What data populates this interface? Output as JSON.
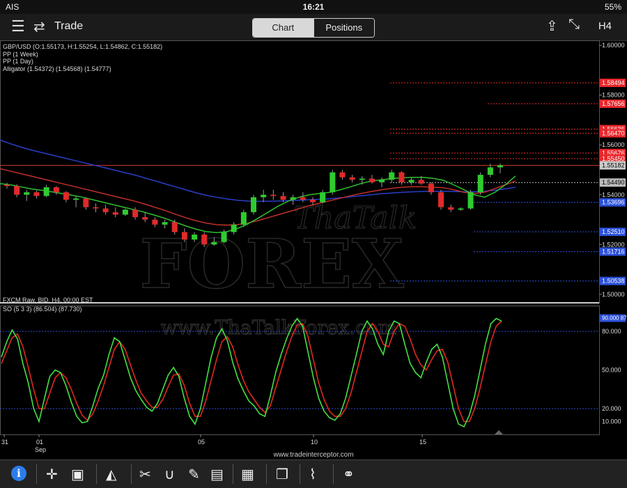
{
  "status": {
    "carrier": "AIS",
    "time": "16:21",
    "battery": "55%"
  },
  "nav": {
    "title": "Trade",
    "tabs": [
      "Chart",
      "Positions"
    ],
    "timeframe": "H4"
  },
  "legend": {
    "line1": "GBP/USD (O:1.55173, H:1.55254, L:1.54862, C:1.55182)",
    "line2": "PP (1 Week)",
    "line3": "PP (1 Day)",
    "line4": "Alligator  (1.54372) (1.54568) (1.54777)",
    "feed": "FXCM Raw, BID, H4, 00:00 EST",
    "osc": "SO (5 3 3)  (86.504)  (87.730)"
  },
  "watermark": {
    "line1": "ThaTalk",
    "line2": "FOREX",
    "url": "www.ThaTalkForex.com"
  },
  "footer": "www.tradeinterceptor.com",
  "chart_data": {
    "type": "candlestick",
    "symbol": "GBP/USD",
    "ylim": [
      1.4966,
      1.602
    ],
    "y_ticks": [
      "1.60000",
      "1.58000",
      "1.56000",
      "1.54000",
      "1.52000",
      "1.50000"
    ],
    "x_labels": [
      "31",
      "01",
      "05",
      "10",
      "15"
    ],
    "x_sublabel": "Sep",
    "current_price": "1.55182",
    "current_value": 1.55182,
    "price_labels": [
      {
        "text": "1.58494",
        "value": 1.58494,
        "color": "#e8272b"
      },
      {
        "text": "1.57656",
        "value": 1.57656,
        "color": "#e8272b"
      },
      {
        "text": "1.56636",
        "value": 1.56636,
        "color": "#e8272b"
      },
      {
        "text": "1.56470",
        "value": 1.5647,
        "color": "#e8272b"
      },
      {
        "text": "1.55676",
        "value": 1.55676,
        "color": "#e8272b"
      },
      {
        "text": "1.55450",
        "value": 1.5545,
        "color": "#e8272b"
      },
      {
        "text": "1.54490",
        "value": 1.5449,
        "color": "#bbbbbb"
      },
      {
        "text": "1.53696",
        "value": 1.53696,
        "color": "#2b50d8"
      },
      {
        "text": "1.52510",
        "value": 1.5251,
        "color": "#2b50d8"
      },
      {
        "text": "1.51716",
        "value": 1.51716,
        "color": "#2b50d8"
      },
      {
        "text": "1.50538",
        "value": 1.50538,
        "color": "#2b50d8"
      }
    ],
    "candles": [
      [
        1.544,
        1.5448,
        1.5425,
        1.5435
      ],
      [
        1.5435,
        1.5442,
        1.539,
        1.54
      ],
      [
        1.54,
        1.542,
        1.5375,
        1.541
      ],
      [
        1.541,
        1.5418,
        1.5385,
        1.5395
      ],
      [
        1.5395,
        1.544,
        1.539,
        1.543
      ],
      [
        1.543,
        1.5435,
        1.54,
        1.541
      ],
      [
        1.541,
        1.5415,
        1.537,
        1.538
      ],
      [
        1.538,
        1.5395,
        1.535,
        1.5385
      ],
      [
        1.5385,
        1.539,
        1.534,
        1.535
      ],
      [
        1.535,
        1.5365,
        1.533,
        1.5345
      ],
      [
        1.5345,
        1.536,
        1.532,
        1.533
      ],
      [
        1.533,
        1.535,
        1.531,
        1.532
      ],
      [
        1.532,
        1.5345,
        1.5315,
        1.534
      ],
      [
        1.534,
        1.535,
        1.53,
        1.531
      ],
      [
        1.531,
        1.533,
        1.529,
        1.53
      ],
      [
        1.53,
        1.531,
        1.527,
        1.528
      ],
      [
        1.528,
        1.53,
        1.5265,
        1.529
      ],
      [
        1.529,
        1.53,
        1.524,
        1.525
      ],
      [
        1.525,
        1.5265,
        1.521,
        1.522
      ],
      [
        1.522,
        1.525,
        1.521,
        1.524
      ],
      [
        1.524,
        1.525,
        1.519,
        1.52
      ],
      [
        1.52,
        1.523,
        1.5195,
        1.521
      ],
      [
        1.521,
        1.526,
        1.5205,
        1.525
      ],
      [
        1.525,
        1.529,
        1.524,
        1.528
      ],
      [
        1.528,
        1.534,
        1.527,
        1.533
      ],
      [
        1.533,
        1.54,
        1.532,
        1.539
      ],
      [
        1.539,
        1.542,
        1.537,
        1.54
      ],
      [
        1.54,
        1.542,
        1.538,
        1.5395
      ],
      [
        1.5395,
        1.541,
        1.537,
        1.538
      ],
      [
        1.538,
        1.54,
        1.536,
        1.539
      ],
      [
        1.539,
        1.541,
        1.537,
        1.538
      ],
      [
        1.538,
        1.539,
        1.536,
        1.537
      ],
      [
        1.537,
        1.542,
        1.5365,
        1.541
      ],
      [
        1.541,
        1.55,
        1.54,
        1.549
      ],
      [
        1.549,
        1.55,
        1.546,
        1.547
      ],
      [
        1.547,
        1.548,
        1.545,
        1.546
      ],
      [
        1.546,
        1.5475,
        1.544,
        1.5465
      ],
      [
        1.5465,
        1.548,
        1.5445,
        1.545
      ],
      [
        1.545,
        1.547,
        1.543,
        1.546
      ],
      [
        1.546,
        1.55,
        1.545,
        1.549
      ],
      [
        1.549,
        1.5495,
        1.544,
        1.545
      ],
      [
        1.545,
        1.547,
        1.544,
        1.546
      ],
      [
        1.546,
        1.5475,
        1.544,
        1.5445
      ],
      [
        1.5445,
        1.545,
        1.54,
        1.541
      ],
      [
        1.541,
        1.542,
        1.534,
        1.535
      ],
      [
        1.535,
        1.536,
        1.533,
        1.534
      ],
      [
        1.534,
        1.535,
        1.5335,
        1.5345
      ],
      [
        1.5345,
        1.542,
        1.534,
        1.541
      ],
      [
        1.541,
        1.549,
        1.54,
        1.548
      ],
      [
        1.548,
        1.5525,
        1.547,
        1.551
      ],
      [
        1.551,
        1.5525,
        1.5486,
        1.5518
      ]
    ],
    "ma_blue": [
      1.562,
      1.5605,
      1.5592,
      1.558,
      1.557,
      1.556,
      1.555,
      1.554,
      1.553,
      1.552,
      1.551,
      1.55,
      1.549,
      1.548,
      1.5468,
      1.5456,
      1.5444,
      1.5432,
      1.542,
      1.5408,
      1.5398,
      1.539,
      1.5383,
      1.5378,
      1.5375,
      1.5374,
      1.5374,
      1.5375,
      1.5376,
      1.5378,
      1.538,
      1.5382,
      1.5384,
      1.5388,
      1.5392,
      1.5396,
      1.54,
      1.5404,
      1.5407,
      1.541,
      1.5412,
      1.5413,
      1.5414,
      1.5414,
      1.5413,
      1.5412,
      1.5412,
      1.5414,
      1.5418,
      1.5424,
      1.543
    ],
    "ma_red": [
      1.5505,
      1.5495,
      1.5485,
      1.5475,
      1.5465,
      1.5455,
      1.5445,
      1.5435,
      1.5425,
      1.5415,
      1.5405,
      1.5395,
      1.5385,
      1.5375,
      1.5363,
      1.535,
      1.5337,
      1.5322,
      1.5308,
      1.5296,
      1.5286,
      1.528,
      1.5278,
      1.528,
      1.5286,
      1.5296,
      1.5308,
      1.532,
      1.5332,
      1.5344,
      1.5356,
      1.5366,
      1.5376,
      1.5386,
      1.5396,
      1.5405,
      1.5413,
      1.542,
      1.5426,
      1.543,
      1.5432,
      1.5432,
      1.543,
      1.5428,
      1.542,
      1.541,
      1.5405,
      1.541,
      1.5425,
      1.544,
      1.5455
    ],
    "ma_green": [
      1.5445,
      1.544,
      1.5432,
      1.5424,
      1.5418,
      1.5412,
      1.5405,
      1.5398,
      1.539,
      1.538,
      1.537,
      1.536,
      1.535,
      1.534,
      1.533,
      1.5318,
      1.5305,
      1.529,
      1.5275,
      1.5262,
      1.5252,
      1.5248,
      1.5252,
      1.5264,
      1.5282,
      1.5305,
      1.533,
      1.5355,
      1.5375,
      1.539,
      1.54,
      1.5405,
      1.541,
      1.542,
      1.5432,
      1.5445,
      1.5455,
      1.546,
      1.5465,
      1.5468,
      1.547,
      1.547,
      1.5466,
      1.5458,
      1.544,
      1.542,
      1.54,
      1.539,
      1.541,
      1.544,
      1.5475
    ],
    "oscillator": {
      "name": "SO (5 3 3)",
      "ylim": [
        0,
        100
      ],
      "y_ticks": [
        "80.000",
        "50.000",
        "20.000",
        "10.000"
      ],
      "levels": [
        80,
        20
      ],
      "current_labels": [
        "90.000",
        "87.730"
      ],
      "k_line": [
        60,
        72,
        81,
        74,
        55,
        40,
        20,
        10,
        28,
        45,
        50,
        48,
        38,
        25,
        14,
        9,
        10,
        22,
        36,
        46,
        62,
        75,
        72,
        58,
        44,
        34,
        27,
        21,
        18,
        24,
        35,
        46,
        52,
        45,
        28,
        14,
        8,
        20,
        40,
        60,
        75,
        82,
        73,
        56,
        43,
        34,
        26,
        22,
        16,
        14,
        30,
        48,
        62,
        74,
        84,
        90,
        84,
        64,
        44,
        28,
        18,
        13,
        11,
        16,
        28,
        45,
        62,
        80,
        88,
        82,
        70,
        62,
        80,
        88,
        86,
        70,
        55,
        48,
        44,
        56,
        66,
        70,
        60,
        40,
        20,
        8,
        6,
        15,
        30,
        50,
        70,
        86,
        90,
        88
      ],
      "d_line": [
        55,
        65,
        75,
        78,
        68,
        52,
        35,
        20,
        20,
        32,
        44,
        48,
        44,
        35,
        24,
        15,
        11,
        16,
        26,
        38,
        52,
        66,
        72,
        66,
        54,
        42,
        32,
        26,
        21,
        21,
        27,
        37,
        46,
        47,
        38,
        24,
        14,
        14,
        26,
        42,
        58,
        72,
        76,
        68,
        54,
        42,
        33,
        27,
        21,
        17,
        22,
        36,
        50,
        64,
        76,
        85,
        86,
        76,
        58,
        40,
        27,
        18,
        14,
        14,
        20,
        32,
        48,
        64,
        80,
        86,
        80,
        70,
        68,
        80,
        86,
        84,
        74,
        62,
        54,
        50,
        58,
        65,
        66,
        56,
        38,
        20,
        10,
        10,
        20,
        36,
        54,
        72,
        84,
        88
      ]
    }
  },
  "toolbar": {
    "info": "i"
  }
}
